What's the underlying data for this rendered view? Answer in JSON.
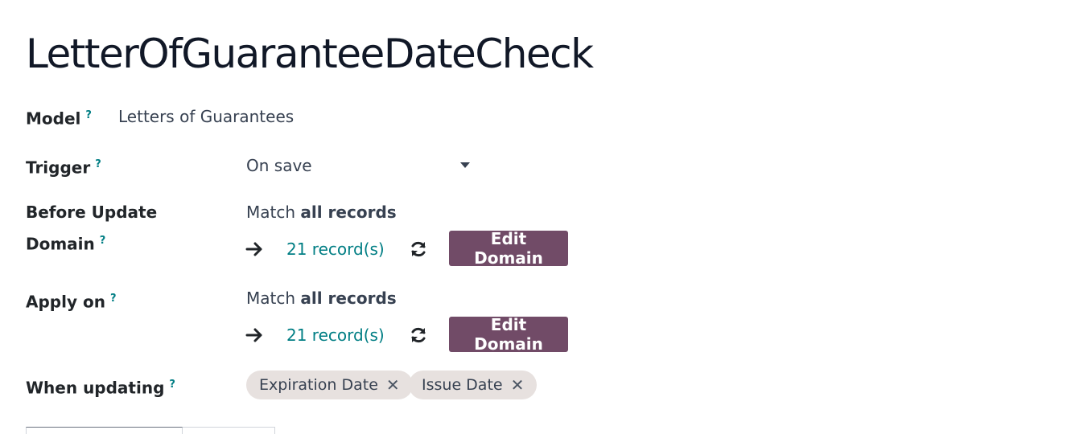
{
  "record": {
    "title": "LetterOfGuaranteeDateCheck"
  },
  "help_mark": "?",
  "fields": {
    "model": {
      "label": "Model",
      "value": "Letters of Guarantees"
    },
    "trigger": {
      "label": "Trigger",
      "value": "On save"
    },
    "before_update_domain": {
      "label_line1": "Before Update",
      "label_line2": "Domain",
      "match_prefix": "Match ",
      "match_bold": "all records",
      "records": "21 record(s)",
      "edit_label": "Edit Domain"
    },
    "apply_on": {
      "label": "Apply on",
      "match_prefix": "Match ",
      "match_bold": "all records",
      "records": "21 record(s)",
      "edit_label": "Edit Domain"
    },
    "when_updating": {
      "label": "When updating",
      "tags": [
        "Expiration Date",
        "Issue Date"
      ],
      "remove_glyph": "✕"
    }
  },
  "colors": {
    "accent": "#017e84",
    "primary_button": "#714b67",
    "tag_background": "#e7e1df"
  },
  "icons": {
    "arrow": "arrow-right-icon",
    "refresh": "refresh-icon",
    "caret": "caret-down-icon"
  }
}
